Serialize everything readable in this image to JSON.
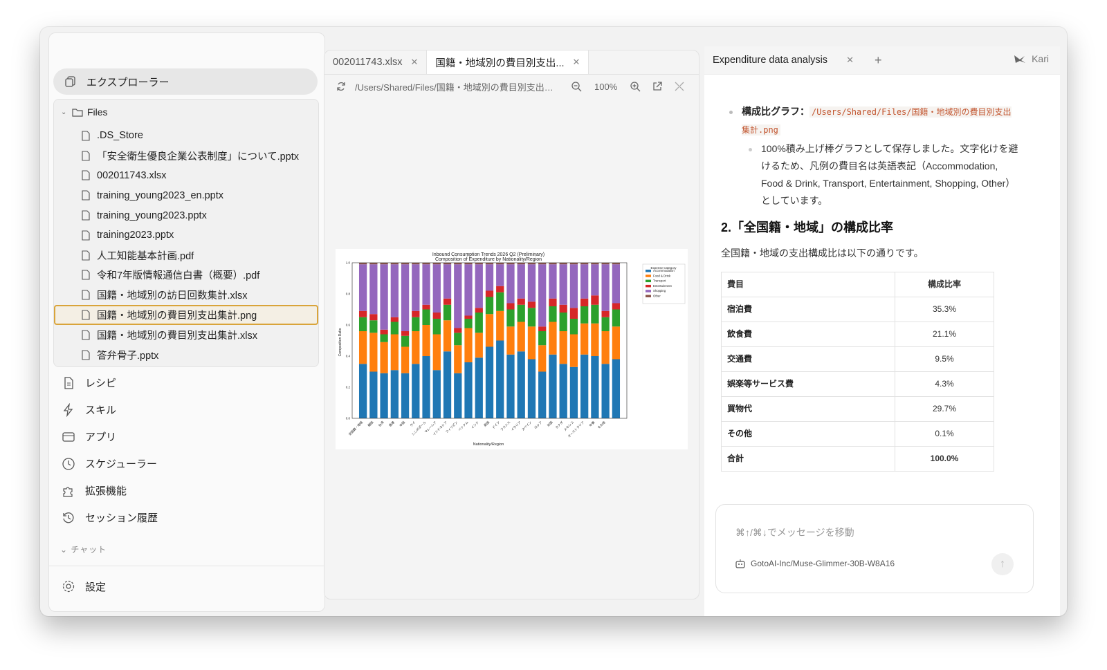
{
  "sidebar": {
    "explorer_label": "エクスプローラー",
    "files_label": "Files",
    "files": [
      ".DS_Store",
      "「安全衛生優良企業公表制度」について.pptx",
      "002011743.xlsx",
      "training_young2023_en.pptx",
      "training_young2023.pptx",
      "training2023.pptx",
      "人工知能基本計画.pdf",
      "令和7年版情報通信白書（概要）.pdf",
      "国籍・地域別の訪日回数集計.xlsx",
      "国籍・地域別の費目別支出集計.png",
      "国籍・地域別の費目別支出集計.xlsx",
      "答弁骨子.pptx"
    ],
    "selected_file_index": 9,
    "nav": [
      "レシピ",
      "スキル",
      "アプリ",
      "スケジューラー",
      "拡張機能",
      "セッション履歴"
    ],
    "chat_label": "チャット",
    "settings_label": "設定"
  },
  "preview": {
    "tabs": [
      "002011743.xlsx",
      "国籍・地域別の費目別支出..."
    ],
    "path": "/Users/Shared/Files/国籍・地域別の費目別支出集...",
    "zoom": "100%"
  },
  "chart_data": {
    "type": "bar",
    "title": "Inbound Consumption Trends 2026 Q2 (Preliminary)",
    "subtitle": "Composition of Expenditure by Nationality/Region",
    "xlabel": "Nationality/Region",
    "ylabel": "Composition Ratio",
    "ylim": [
      0,
      1
    ],
    "yticks": [
      "0.0",
      "0.2",
      "0.4",
      "0.6",
      "0.8",
      "1.0"
    ],
    "legend_title": "Expense Category",
    "legend_placement": "outside-right",
    "categories": [
      "全国籍・地域",
      "韓国",
      "台湾",
      "香港",
      "中国",
      "タイ",
      "シンガポール",
      "マレーシア",
      "インドネシア",
      "フィリピン",
      "ベトナム",
      "インド",
      "英国",
      "ドイツ",
      "フランス",
      "イタリア",
      "スペイン",
      "ロシア",
      "米国",
      "カナダ",
      "メキシコ",
      "オーストラリア",
      "中東",
      "その他"
    ],
    "colors": [
      "#1f77b4",
      "#ff7f0e",
      "#2ca02c",
      "#d62728",
      "#9467bd",
      "#8c564b"
    ],
    "series": [
      {
        "name": "Accommodation",
        "values": [
          0.35,
          0.3,
          0.29,
          0.31,
          0.29,
          0.35,
          0.4,
          0.31,
          0.43,
          0.29,
          0.36,
          0.39,
          0.46,
          0.5,
          0.41,
          0.43,
          0.38,
          0.3,
          0.41,
          0.35,
          0.33,
          0.41,
          0.4,
          0.35,
          0.38
        ]
      },
      {
        "name": "Food & Drink",
        "values": [
          0.21,
          0.25,
          0.2,
          0.23,
          0.17,
          0.21,
          0.2,
          0.23,
          0.2,
          0.18,
          0.22,
          0.16,
          0.21,
          0.19,
          0.18,
          0.19,
          0.21,
          0.17,
          0.21,
          0.21,
          0.21,
          0.2,
          0.21,
          0.21,
          0.21
        ]
      },
      {
        "name": "Transport",
        "values": [
          0.09,
          0.08,
          0.05,
          0.08,
          0.07,
          0.09,
          0.1,
          0.1,
          0.1,
          0.08,
          0.06,
          0.13,
          0.11,
          0.12,
          0.11,
          0.11,
          0.12,
          0.09,
          0.1,
          0.12,
          0.1,
          0.11,
          0.12,
          0.09,
          0.11
        ]
      },
      {
        "name": "Entertainment",
        "values": [
          0.04,
          0.04,
          0.03,
          0.03,
          0.03,
          0.04,
          0.03,
          0.04,
          0.04,
          0.03,
          0.02,
          0.03,
          0.04,
          0.04,
          0.04,
          0.04,
          0.04,
          0.03,
          0.05,
          0.05,
          0.07,
          0.05,
          0.06,
          0.04,
          0.04
        ]
      },
      {
        "name": "Shopping",
        "values": [
          0.3,
          0.32,
          0.42,
          0.34,
          0.43,
          0.3,
          0.26,
          0.31,
          0.22,
          0.41,
          0.33,
          0.28,
          0.17,
          0.14,
          0.25,
          0.22,
          0.24,
          0.4,
          0.22,
          0.26,
          0.28,
          0.22,
          0.2,
          0.3,
          0.25
        ]
      },
      {
        "name": "Other",
        "values": [
          0.01,
          0.01,
          0.01,
          0.01,
          0.01,
          0.01,
          0.01,
          0.01,
          0.01,
          0.01,
          0.01,
          0.01,
          0.01,
          0.01,
          0.01,
          0.01,
          0.01,
          0.01,
          0.01,
          0.01,
          0.01,
          0.01,
          0.01,
          0.01,
          0.01
        ]
      }
    ]
  },
  "chat": {
    "tab_label": "Expenditure data analysis",
    "user": "Kari",
    "bullet_title": "構成比グラフ：",
    "bullet_path": "/Users/Shared/Files/国籍・地域別の費目別支出集計.png",
    "sub_bullet": "100%積み上げ棒グラフとして保存しました。文字化けを避けるため、凡例の費目名は英語表記（Accommodation, Food & Drink, Transport, Entertainment, Shopping, Other）としています。",
    "heading_num": "2.",
    "heading": "「全国籍・地域」の構成比率",
    "paragraph": "全国籍・地域の支出構成比は以下の通りです。",
    "table": {
      "headers": [
        "費目",
        "構成比率"
      ],
      "rows": [
        [
          "宿泊費",
          "35.3%"
        ],
        [
          "飲食費",
          "21.1%"
        ],
        [
          "交通費",
          "9.5%"
        ],
        [
          "娯楽等サービス費",
          "4.3%"
        ],
        [
          "買物代",
          "29.7%"
        ],
        [
          "その他",
          "0.1%"
        ],
        [
          "合計",
          "100.0%"
        ]
      ]
    },
    "composer_placeholder": "⌘↑/⌘↓でメッセージを移動",
    "model": "GotoAI-Inc/Muse-Glimmer-30B-W8A16"
  }
}
